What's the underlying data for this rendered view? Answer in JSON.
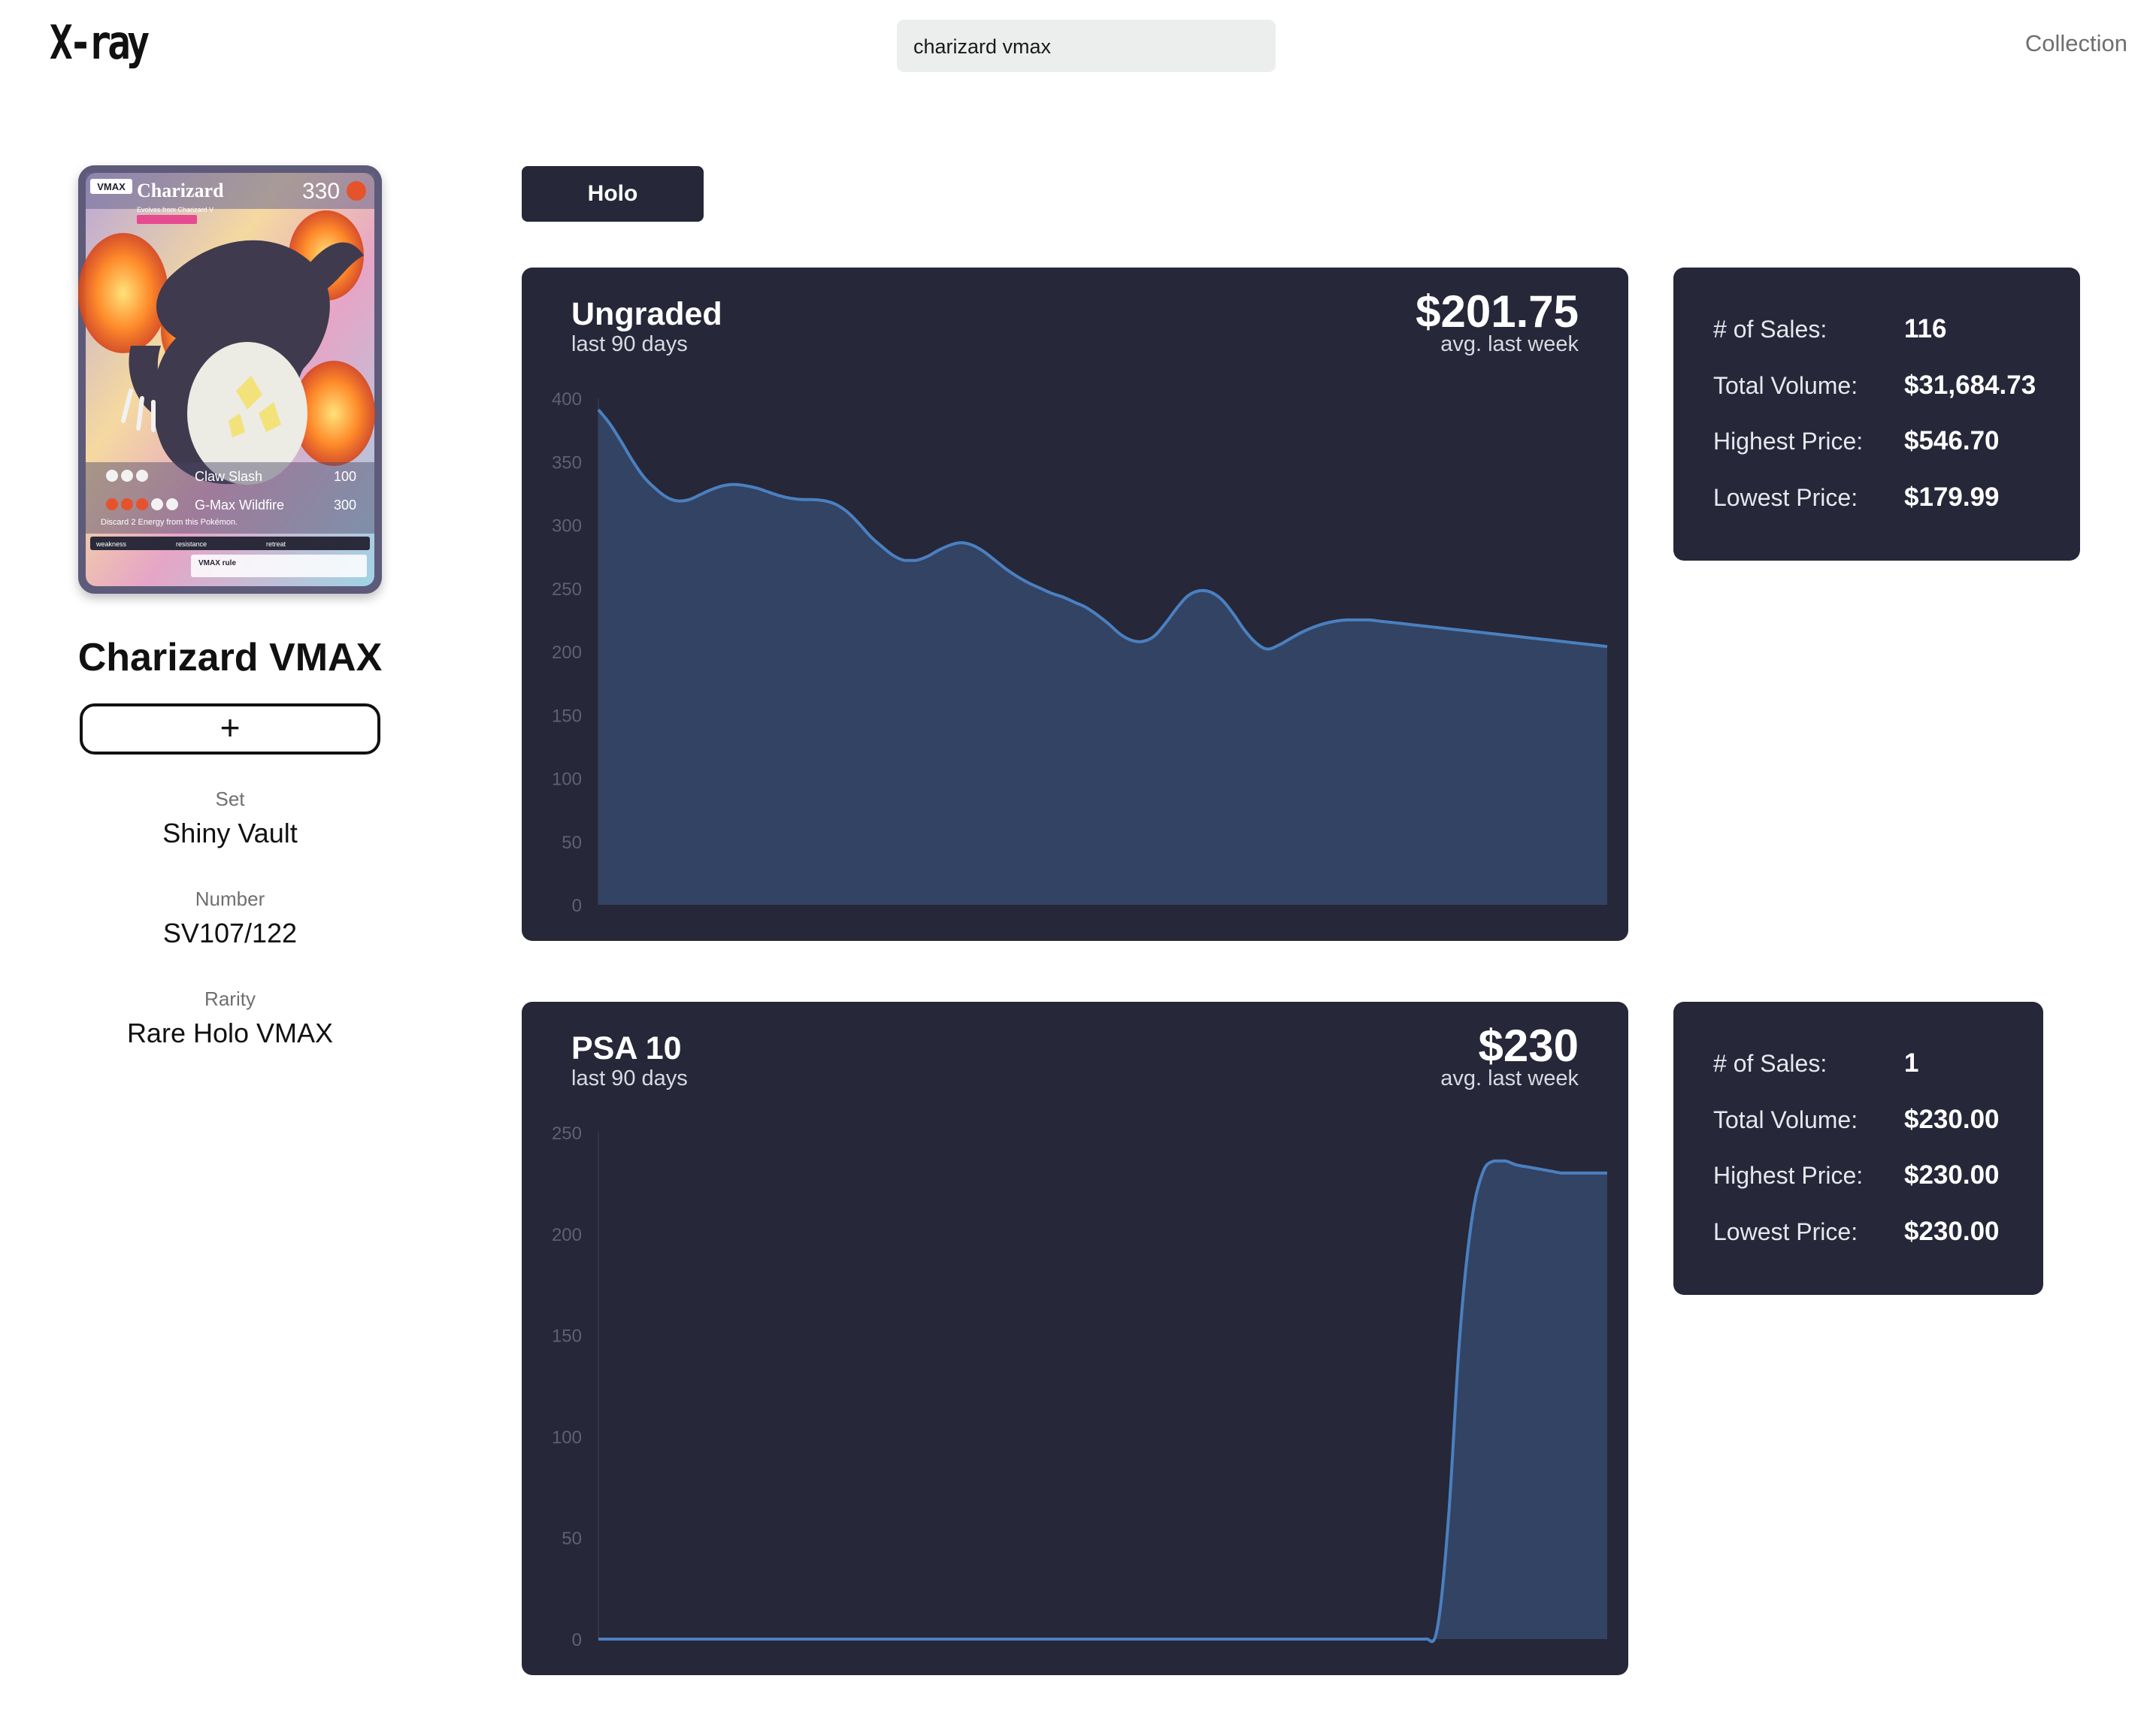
{
  "app": {
    "logo": "X-ray",
    "search_value": "charizard vmax",
    "nav_collection": "Collection"
  },
  "card": {
    "name": "Charizard VMAX",
    "add_label": "+",
    "set_label": "Set",
    "set_value": "Shiny Vault",
    "number_label": "Number",
    "number_value": "SV107/122",
    "rarity_label": "Rarity",
    "rarity_value": "Rare Holo VMAX",
    "art": {
      "name": "Charizard",
      "stage_badge": "VMAX",
      "hp": "330",
      "evolves": "Evolves from Charizard V",
      "attack1_name": "Claw Slash",
      "attack1_damage": "100",
      "attack2_name": "G-Max Wildfire",
      "attack2_damage": "300",
      "attack2_text": "Discard 2 Energy from this Pokémon.",
      "weakness": "weakness",
      "resistance": "resistance",
      "retreat": "retreat",
      "rule": "VMAX rule"
    }
  },
  "variant": {
    "selected": "Holo"
  },
  "colors": {
    "panel_bg": "#262738",
    "area_fill": "#334364",
    "line_stroke": "#4a80c0",
    "tick_color": "#5f6172"
  },
  "panels": [
    {
      "title": "Ungraded",
      "subtitle": "last 90 days",
      "price": "$201.75",
      "price_sub": "avg. last week",
      "stats": [
        {
          "label": "# of Sales:",
          "value": "116"
        },
        {
          "label": "Total Volume:",
          "value": "$31,684.73"
        },
        {
          "label": "Highest Price:",
          "value": "$546.70"
        },
        {
          "label": "Lowest Price:",
          "value": "$179.99"
        }
      ]
    },
    {
      "title": "PSA 10",
      "subtitle": "last 90 days",
      "price": "$230",
      "price_sub": "avg. last week",
      "stats": [
        {
          "label": "# of Sales:",
          "value": "1"
        },
        {
          "label": "Total Volume:",
          "value": "$230.00"
        },
        {
          "label": "Highest Price:",
          "value": "$230.00"
        },
        {
          "label": "Lowest Price:",
          "value": "$230.00"
        }
      ]
    }
  ],
  "chart_data": [
    {
      "type": "area",
      "title": "Ungraded",
      "subtitle": "last 90 days",
      "xlabel": "",
      "ylabel": "",
      "ylim": [
        0,
        400
      ],
      "yticks": [
        400,
        350,
        300,
        250,
        200,
        150,
        100,
        50,
        0
      ],
      "grid": false,
      "x": [
        0,
        1,
        2,
        3,
        4,
        5,
        6,
        7,
        8,
        9,
        10,
        11,
        12,
        13,
        14,
        15,
        16,
        17,
        18,
        19,
        20,
        21,
        22,
        23,
        24,
        25,
        26,
        27,
        28,
        29,
        30,
        31,
        32,
        33,
        34,
        35,
        36,
        37,
        38,
        39,
        40,
        41,
        42,
        43,
        44,
        45,
        46,
        47,
        48,
        49,
        50,
        51,
        52,
        53,
        54,
        55,
        56,
        57,
        58,
        59,
        60,
        61,
        62,
        63,
        64,
        65,
        66,
        67,
        68,
        69,
        70,
        71,
        72,
        73,
        74,
        75,
        76,
        77,
        78,
        79,
        80,
        81,
        82,
        83,
        84,
        85,
        86,
        87,
        88,
        89
      ],
      "series": [
        {
          "values": [
            391,
            380,
            366,
            351,
            338,
            329,
            322,
            319,
            320,
            324,
            328,
            331,
            332,
            331,
            329,
            326,
            323,
            321,
            320,
            320,
            319,
            316,
            310,
            301,
            291,
            283,
            276,
            272,
            272,
            275,
            280,
            284,
            286,
            284,
            279,
            272,
            265,
            259,
            254,
            250,
            246,
            243,
            239,
            235,
            229,
            222,
            214,
            209,
            208,
            212,
            222,
            234,
            244,
            248,
            247,
            241,
            230,
            217,
            207,
            202,
            205,
            210,
            215,
            219,
            222,
            224,
            225,
            225,
            225,
            224,
            223,
            222,
            221,
            220,
            219,
            218,
            217,
            216,
            215,
            214,
            213,
            212,
            211,
            210,
            209,
            208,
            207,
            206,
            205,
            204
          ]
        }
      ]
    },
    {
      "type": "area",
      "title": "PSA 10",
      "subtitle": "last 90 days",
      "xlabel": "",
      "ylabel": "",
      "ylim": [
        0,
        250
      ],
      "yticks": [
        250,
        200,
        150,
        100,
        50,
        0
      ],
      "grid": false,
      "x": [
        0,
        1,
        2,
        3,
        4,
        5,
        6,
        7,
        8,
        9,
        10,
        11,
        12,
        13,
        14,
        15,
        16,
        17,
        18,
        19,
        20,
        21,
        22,
        23,
        24,
        25,
        26,
        27,
        28,
        29,
        30,
        31,
        32,
        33,
        34,
        35,
        36,
        37,
        38,
        39,
        40,
        41,
        42,
        43,
        44,
        45,
        46,
        47,
        48,
        49,
        50,
        51,
        52,
        53,
        54,
        55,
        56,
        57,
        58,
        59,
        60,
        61,
        62,
        63,
        64,
        65,
        66,
        67,
        68,
        69,
        70,
        71,
        72,
        73,
        74,
        75,
        76,
        77,
        78,
        79,
        80,
        81,
        82,
        83,
        84,
        85,
        86,
        87,
        88,
        89
      ],
      "series": [
        {
          "values": [
            0,
            0,
            0,
            0,
            0,
            0,
            0,
            0,
            0,
            0,
            0,
            0,
            0,
            0,
            0,
            0,
            0,
            0,
            0,
            0,
            0,
            0,
            0,
            0,
            0,
            0,
            0,
            0,
            0,
            0,
            0,
            0,
            0,
            0,
            0,
            0,
            0,
            0,
            0,
            0,
            0,
            0,
            0,
            0,
            0,
            0,
            0,
            0,
            0,
            0,
            0,
            0,
            0,
            0,
            0,
            0,
            0,
            0,
            0,
            0,
            0,
            0,
            0,
            0,
            0,
            0,
            0,
            0,
            0,
            0,
            0,
            0,
            0,
            0,
            5,
            60,
            150,
            205,
            230,
            236,
            236,
            234,
            233,
            232,
            231,
            230,
            230,
            230,
            230,
            230
          ]
        }
      ]
    }
  ]
}
